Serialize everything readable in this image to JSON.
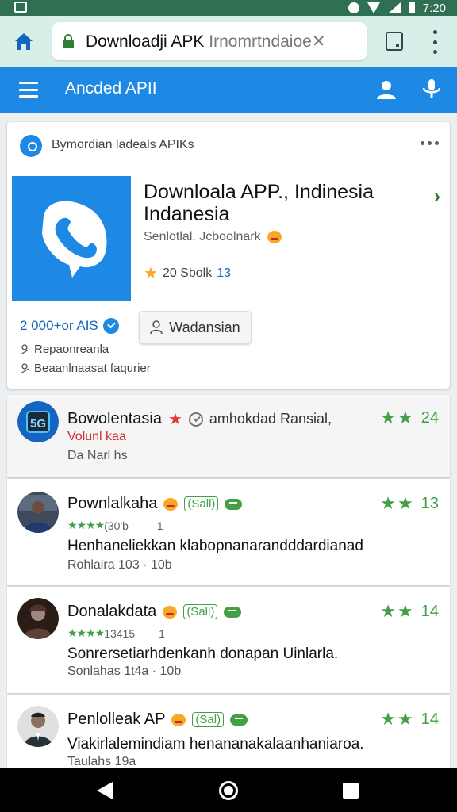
{
  "status_bar": {
    "time": "7:20"
  },
  "browser": {
    "url_main": "Downloadji APK ",
    "url_hint": "Irnomrtndaioe",
    "close_glyph": "✕"
  },
  "app_bar": {
    "title": "Ancded APII"
  },
  "main_card": {
    "header_text": "Bymordian ladeals APIKs",
    "app_name": "Downloala APP., Indinesia Indanesia",
    "subtitle": "Senlotlal. Jcboolnark",
    "rating_text": "20 Sbolk",
    "rating_value": "13",
    "downloads": "2 000+or AIS",
    "download_button": "Wadansian",
    "meta_1": "Repaonreanla",
    "meta_2": "Beaanlnaasat faqurier",
    "chevron": "›"
  },
  "list_items": [
    {
      "name": "Bowolentasia",
      "extra": "amhokdad Ransial,",
      "side_value": "24",
      "red_line": "Volunl kaa",
      "meta": "Da Narl hs"
    },
    {
      "name": "Pownlalkaha",
      "tag": "(Sall)",
      "side_value": "13",
      "stars_text": "(30'b",
      "stars_extra": "1",
      "desc": "Henhaneliekkan klabopnanarandddardianad",
      "meta": "Rohlaira 103 · 10b"
    },
    {
      "name": "Donalakdata",
      "tag": "(Sall)",
      "side_value": "14",
      "stars_text": "13415",
      "stars_extra": "1",
      "desc": "Sonrersetiarhdenkanh donapan Uinlarla.",
      "meta": "Sonlahas 1t4a · 10b"
    },
    {
      "name": "Penlolleak AP",
      "tag": "(Sal)",
      "side_value": "14",
      "desc": "Viakirlalemindiam henananakalaanhaniaroa.",
      "meta": "Taulahs 19a"
    }
  ],
  "colors": {
    "accent": "#1e88e5",
    "green": "#43a047",
    "status": "#2f6f52"
  }
}
